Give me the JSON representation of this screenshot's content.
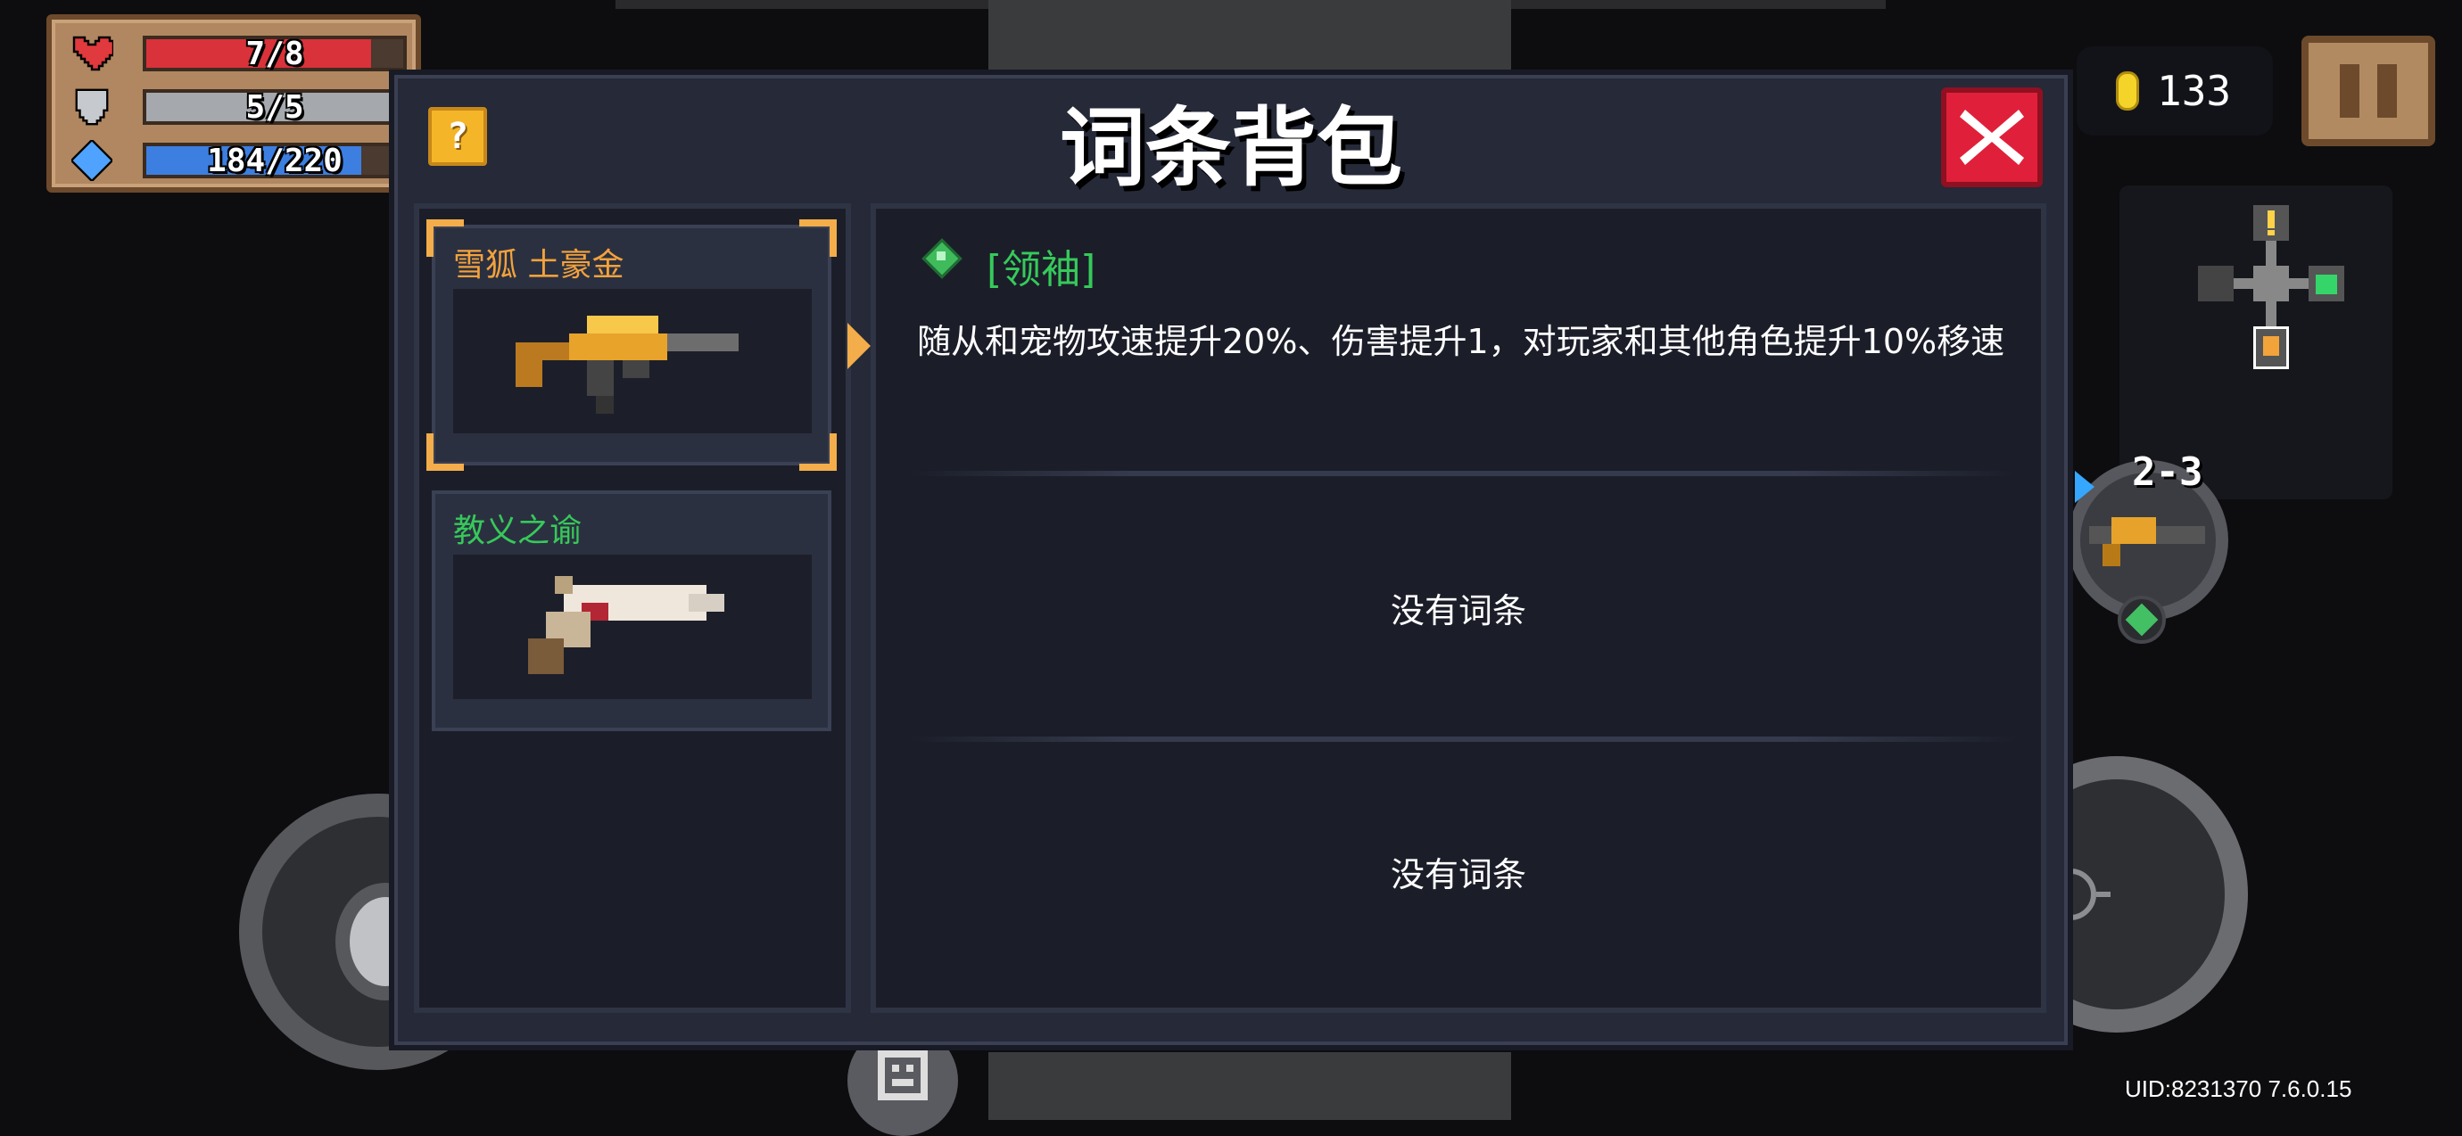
{
  "hud": {
    "hp": "7/8",
    "hp_fraction": 0.875,
    "armor": "5/5",
    "armor_fraction": 1.0,
    "energy": "184/220",
    "energy_fraction": 0.836,
    "coins": "133",
    "level": "2-3"
  },
  "modal": {
    "title": "词条背包",
    "help_label": "?",
    "items": [
      {
        "name": "雪狐 土豪金",
        "color": "#f3a23c",
        "selected": true
      },
      {
        "name": "教义之谕",
        "color": "#36c95a",
        "selected": false
      }
    ],
    "affix": {
      "title": "[领袖]",
      "description": "随从和宠物攻速提升20%、伤害提升1，对玩家和其他角色提升10%移速"
    },
    "empty_slots": [
      "没有词条",
      "没有词条"
    ]
  },
  "footer": {
    "uid": "UID:8231370 7.6.0.15"
  },
  "colors": {
    "hp": "#d9323a",
    "armor": "#a5a8ad",
    "energy": "#3d7fe0",
    "accent_gold": "#f3ad4a",
    "affix_green": "#36c95a",
    "close_red": "#e0203a"
  }
}
